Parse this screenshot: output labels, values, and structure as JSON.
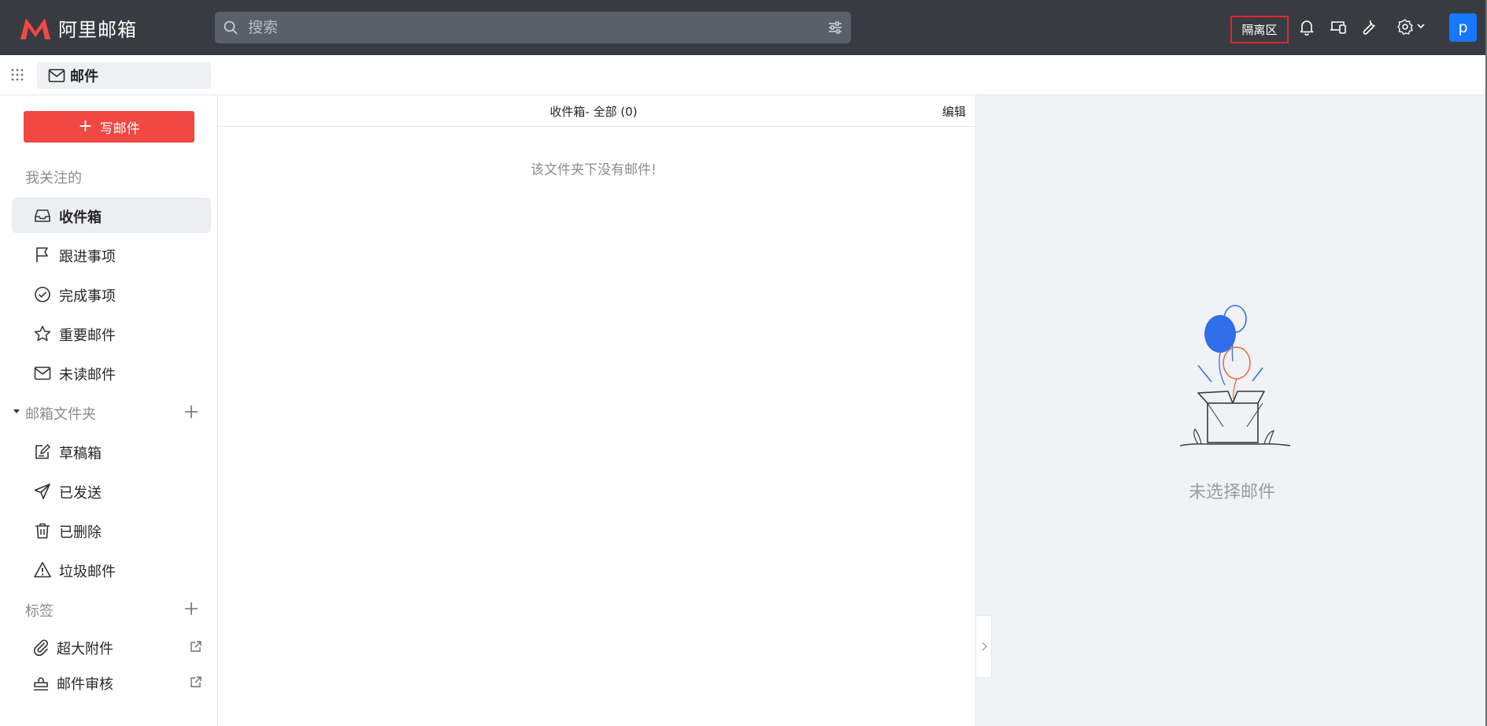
{
  "topbar": {
    "logo_text": "阿里邮箱",
    "search_placeholder": "搜索",
    "quarantine_label": "隔离区",
    "avatar_letter": "p"
  },
  "appbar": {
    "tab_label": "邮件"
  },
  "sidebar": {
    "compose_label": "写邮件",
    "section_following": "我关注的",
    "following_items": [
      {
        "label": "收件箱",
        "icon": "inbox-icon",
        "active": true
      },
      {
        "label": "跟进事项",
        "icon": "flag-icon"
      },
      {
        "label": "完成事项",
        "icon": "check-circle-icon"
      },
      {
        "label": "重要邮件",
        "icon": "star-icon"
      },
      {
        "label": "未读邮件",
        "icon": "envelope-icon"
      }
    ],
    "section_folders": "邮箱文件夹",
    "folder_items": [
      {
        "label": "草稿箱",
        "icon": "draft-icon"
      },
      {
        "label": "已发送",
        "icon": "send-icon"
      },
      {
        "label": "已删除",
        "icon": "trash-icon"
      },
      {
        "label": "垃圾邮件",
        "icon": "warning-icon"
      }
    ],
    "section_tags": "标签",
    "tag_items": [
      {
        "label": "超大附件",
        "icon": "paperclip-icon"
      },
      {
        "label": "邮件审核",
        "icon": "stamp-icon"
      }
    ]
  },
  "list": {
    "folder_title": "收件箱- 全部 (0)",
    "edit_label": "编辑",
    "empty_message": "该文件夹下没有邮件!"
  },
  "reader": {
    "no_selection": "未选择邮件"
  },
  "colors": {
    "topbar_bg": "#383c42",
    "brand_red": "#f04842",
    "avatar_blue": "#1677ff",
    "quarantine_border": "#e0262f"
  }
}
